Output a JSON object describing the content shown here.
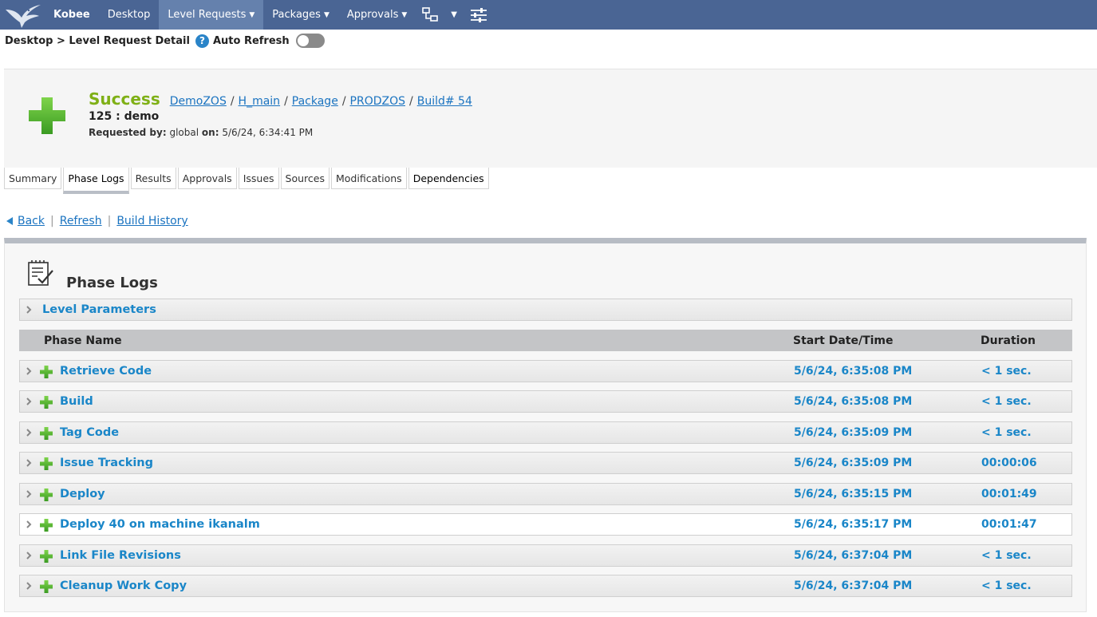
{
  "nav": {
    "brand": "Kobee",
    "items": [
      {
        "label": "Desktop",
        "dropdown": false,
        "active": false
      },
      {
        "label": "Level Requests",
        "dropdown": true,
        "active": true
      },
      {
        "label": "Packages",
        "dropdown": true,
        "active": false
      },
      {
        "label": "Approvals",
        "dropdown": true,
        "active": false
      }
    ],
    "icons": [
      "hierarchy-icon",
      "dropdown-caret-icon",
      "sliders-icon"
    ],
    "bg_color": "#4a6594",
    "active_color": "#6581ad"
  },
  "breadcrumb": {
    "text": "Desktop > Level Request Detail",
    "help_glyph": "?",
    "auto_refresh_label": "Auto Refresh",
    "auto_refresh_on": false
  },
  "request": {
    "status": "Success",
    "status_color": "#7fb016",
    "path": [
      "DemoZOS",
      "H_main",
      "Package",
      "PRODZOS",
      "Build# 54"
    ],
    "path_separator": "/",
    "name": "125 : demo",
    "requested_by_label": "Requested by:",
    "requested_by": "global",
    "on_label": "on:",
    "on": "5/6/24, 6:34:41 PM"
  },
  "tabs": [
    {
      "label": "Summary",
      "active": false
    },
    {
      "label": "Phase Logs",
      "active": true
    },
    {
      "label": "Results",
      "active": false
    },
    {
      "label": "Approvals",
      "active": false
    },
    {
      "label": "Issues",
      "active": false
    },
    {
      "label": "Sources",
      "active": false
    },
    {
      "label": "Modifications",
      "active": false
    },
    {
      "label": "Dependencies",
      "active": false
    }
  ],
  "links": {
    "back": "Back",
    "refresh": "Refresh",
    "build_history": "Build History",
    "separator": "|"
  },
  "phase_logs": {
    "title": "Phase Logs",
    "level_parameters": "Level Parameters",
    "columns": {
      "name": "Phase Name",
      "start": "Start Date/Time",
      "duration": "Duration"
    },
    "rows": [
      {
        "name": "Retrieve Code",
        "start": "5/6/24, 6:35:08 PM",
        "duration": "< 1 sec.",
        "status": "success"
      },
      {
        "name": "Build",
        "start": "5/6/24, 6:35:08 PM",
        "duration": "< 1 sec.",
        "status": "success"
      },
      {
        "name": "Tag Code",
        "start": "5/6/24, 6:35:09 PM",
        "duration": "< 1 sec.",
        "status": "success"
      },
      {
        "name": "Issue Tracking",
        "start": "5/6/24, 6:35:09 PM",
        "duration": "00:00:06",
        "status": "success"
      },
      {
        "name": "Deploy",
        "start": "5/6/24, 6:35:15 PM",
        "duration": "00:01:49",
        "status": "success"
      },
      {
        "name": "Deploy 40 on machine ikanalm",
        "start": "5/6/24, 6:35:17 PM",
        "duration": "00:01:47",
        "status": "success"
      },
      {
        "name": "Link File Revisions",
        "start": "5/6/24, 6:37:04 PM",
        "duration": "< 1 sec.",
        "status": "success"
      },
      {
        "name": "Cleanup Work Copy",
        "start": "5/6/24, 6:37:04 PM",
        "duration": "< 1 sec.",
        "status": "success"
      }
    ],
    "link_color": "#1a86c8"
  }
}
